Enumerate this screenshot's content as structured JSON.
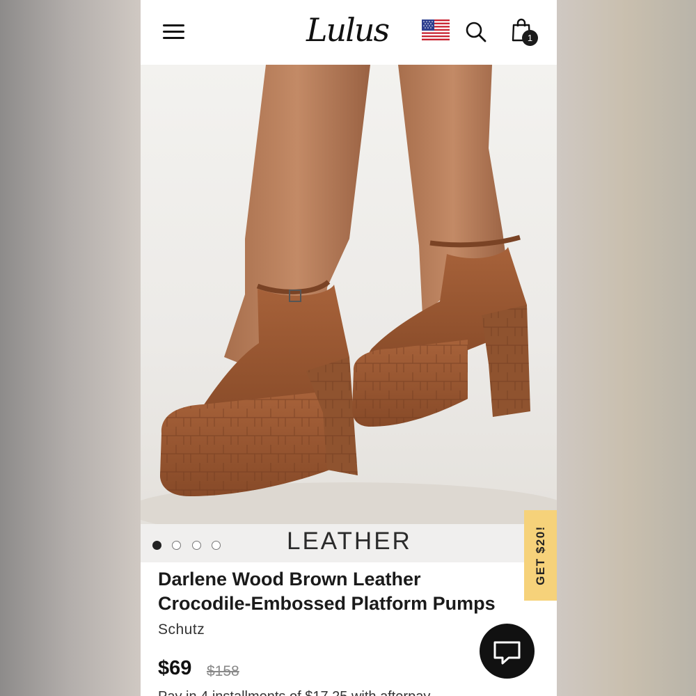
{
  "header": {
    "logo_text": "Lulus",
    "cart_count": "1"
  },
  "hero": {
    "image_description": "brown crocodile-embossed platform pumps"
  },
  "carousel": {
    "label": "LEATHER",
    "slides": 4,
    "active_index": 0
  },
  "promo": {
    "label": "GET $20!"
  },
  "product": {
    "title_line1": "Darlene Wood Brown Leather",
    "title_line2": "Crocodile-Embossed Platform Pumps",
    "brand": "Schutz",
    "price": "$69",
    "original_price": "$158",
    "installments_text": "Pay in 4 installments of $17.25 with afterpay"
  },
  "colors": {
    "shoe_brown": "#9a5a34",
    "promo_yellow": "#f6d27a",
    "chat_bg": "#111111"
  }
}
